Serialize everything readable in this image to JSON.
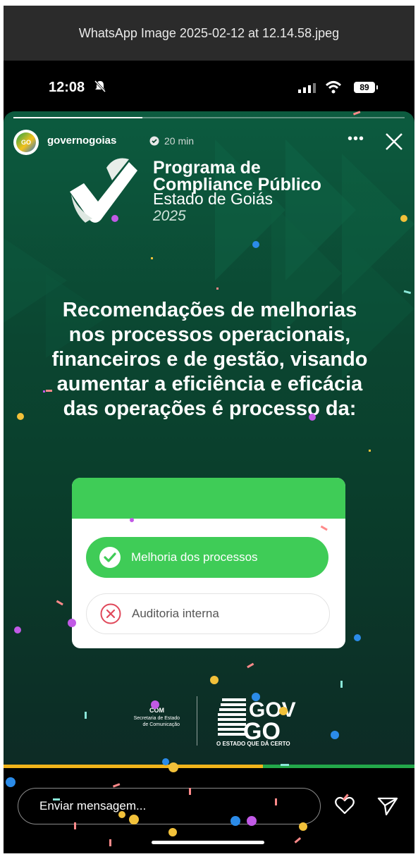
{
  "viewer": {
    "title": "WhatsApp Image 2025-02-12 at 12.14.58.jpeg"
  },
  "status_bar": {
    "time": "12:08",
    "battery": "89"
  },
  "story": {
    "progress": 0.33,
    "username": "governogoias",
    "time_ago": "20 min",
    "program": {
      "line1": "Programa de",
      "line2": "Compliance Público",
      "line3": "Estado de Goiás",
      "year": "2025"
    },
    "question": "Recomendações de melhorias nos processos operacionais, financeiros e de gestão, visando aumentar a eficiência e eficácia das operações é processo da:",
    "quiz": {
      "options": [
        {
          "label": "Melhoria dos processos",
          "state": "correct"
        },
        {
          "label": "Auditoria interna",
          "state": "wrong"
        }
      ]
    },
    "footer": {
      "secom_name": "COM",
      "secom_sub1": "Secretaria de Estado",
      "secom_sub2": "de Comunicação",
      "gov_logo_top": "GOV",
      "gov_logo_bottom": "GO",
      "slogan": "O ESTADO QUE DÁ CERTO"
    }
  },
  "reply": {
    "placeholder": "Enviar mensagem..."
  },
  "colors": {
    "story_green": "#0b4631",
    "quiz_green": "#3fcc57",
    "wrong_red": "#e0485a",
    "bar_yellow": "#f2b41b",
    "bar_green": "#23a84a"
  },
  "icons": [
    "mute-bell-icon",
    "signal-icon",
    "wifi-icon",
    "verified-icon",
    "more-icon",
    "close-icon",
    "check-circle-icon",
    "x-circle-icon",
    "heart-icon",
    "send-icon"
  ]
}
